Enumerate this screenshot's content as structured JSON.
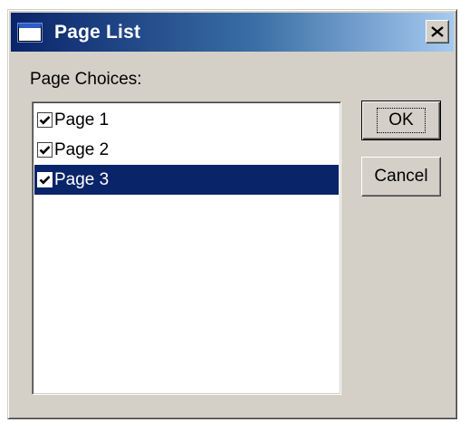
{
  "window": {
    "title": "Page List",
    "title_icon": "window-icon",
    "close_icon": "close-icon",
    "colors": {
      "title_start": "#0a246a",
      "title_end": "#a6caf0",
      "face": "#d4d0c8",
      "selection": "#0a246a"
    }
  },
  "choices": {
    "label": "Page Choices:",
    "items": [
      {
        "label": "Page 1",
        "checked": true,
        "selected": false
      },
      {
        "label": "Page 2",
        "checked": true,
        "selected": false
      },
      {
        "label": "Page 3",
        "checked": true,
        "selected": true
      }
    ]
  },
  "buttons": {
    "ok_label": "OK",
    "cancel_label": "Cancel"
  }
}
